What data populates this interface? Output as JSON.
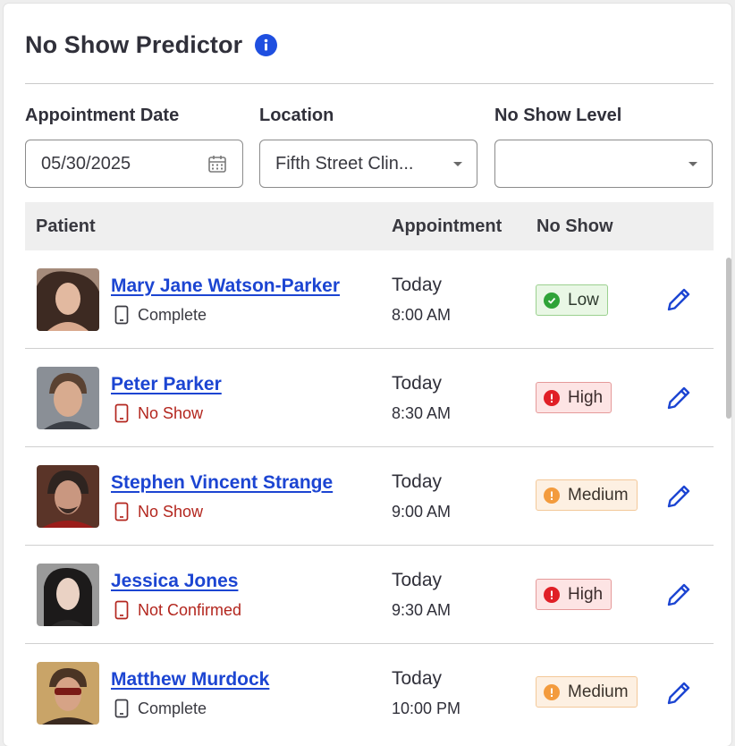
{
  "header": {
    "title": "No Show Predictor",
    "info_icon": "info-circle-icon"
  },
  "filters": {
    "date": {
      "label": "Appointment Date",
      "value": "05/30/2025",
      "icon": "calendar-icon"
    },
    "location": {
      "label": "Location",
      "value": "Fifth Street Clin..."
    },
    "level": {
      "label": "No Show Level",
      "value": ""
    }
  },
  "table": {
    "headers": {
      "patient": "Patient",
      "appointment": "Appointment",
      "no_show": "No Show"
    },
    "rows": [
      {
        "name": "Mary Jane Watson-Parker",
        "status": "Complete",
        "status_kind": "ok",
        "day": "Today",
        "time": "8:00 AM",
        "level": "Low",
        "level_kind": "low"
      },
      {
        "name": "Peter Parker",
        "status": "No Show",
        "status_kind": "bad",
        "day": "Today",
        "time": "8:30 AM",
        "level": "High",
        "level_kind": "high"
      },
      {
        "name": "Stephen Vincent Strange",
        "status": "No Show",
        "status_kind": "bad",
        "day": "Today",
        "time": "9:00 AM",
        "level": "Medium",
        "level_kind": "medium"
      },
      {
        "name": "Jessica Jones",
        "status": "Not Confirmed",
        "status_kind": "bad",
        "day": "Today",
        "time": "9:30 AM",
        "level": "High",
        "level_kind": "high"
      },
      {
        "name": "Matthew Murdock",
        "status": "Complete",
        "status_kind": "ok",
        "day": "Today",
        "time": "10:00 PM",
        "level": "Medium",
        "level_kind": "medium"
      }
    ]
  },
  "colors": {
    "accent": "#1c45d2",
    "low": "#2fa338",
    "high": "#e01f26",
    "medium": "#f39b3d",
    "danger_text": "#b3261e"
  }
}
